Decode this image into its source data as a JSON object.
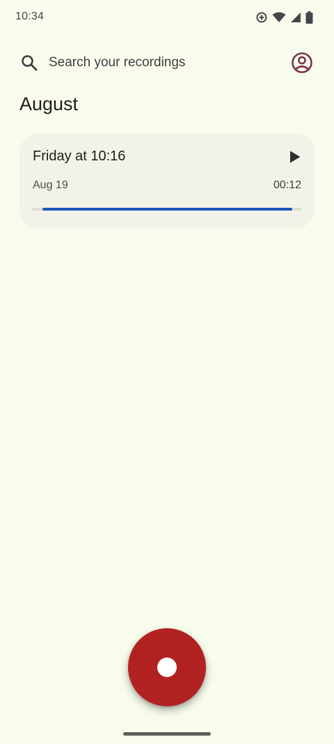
{
  "status_bar": {
    "time": "10:34",
    "icons": [
      "data-saver-icon",
      "wifi-icon",
      "cellular-signal-icon",
      "battery-icon"
    ]
  },
  "search": {
    "placeholder": "Search your recordings",
    "icon": "search-icon",
    "account_icon": "account-circle-icon"
  },
  "section": {
    "title": "August"
  },
  "recordings": [
    {
      "title": "Friday at 10:16",
      "date": "Aug 19",
      "duration": "00:12",
      "progress_percent": 96
    }
  ],
  "record_button": {
    "icon": "record-dot-icon"
  },
  "colors": {
    "background": "#F8FCEC",
    "card": "#F2F2E8",
    "progress": "#1F55B8",
    "record": "#B22222",
    "account_accent": "#7A3350"
  }
}
